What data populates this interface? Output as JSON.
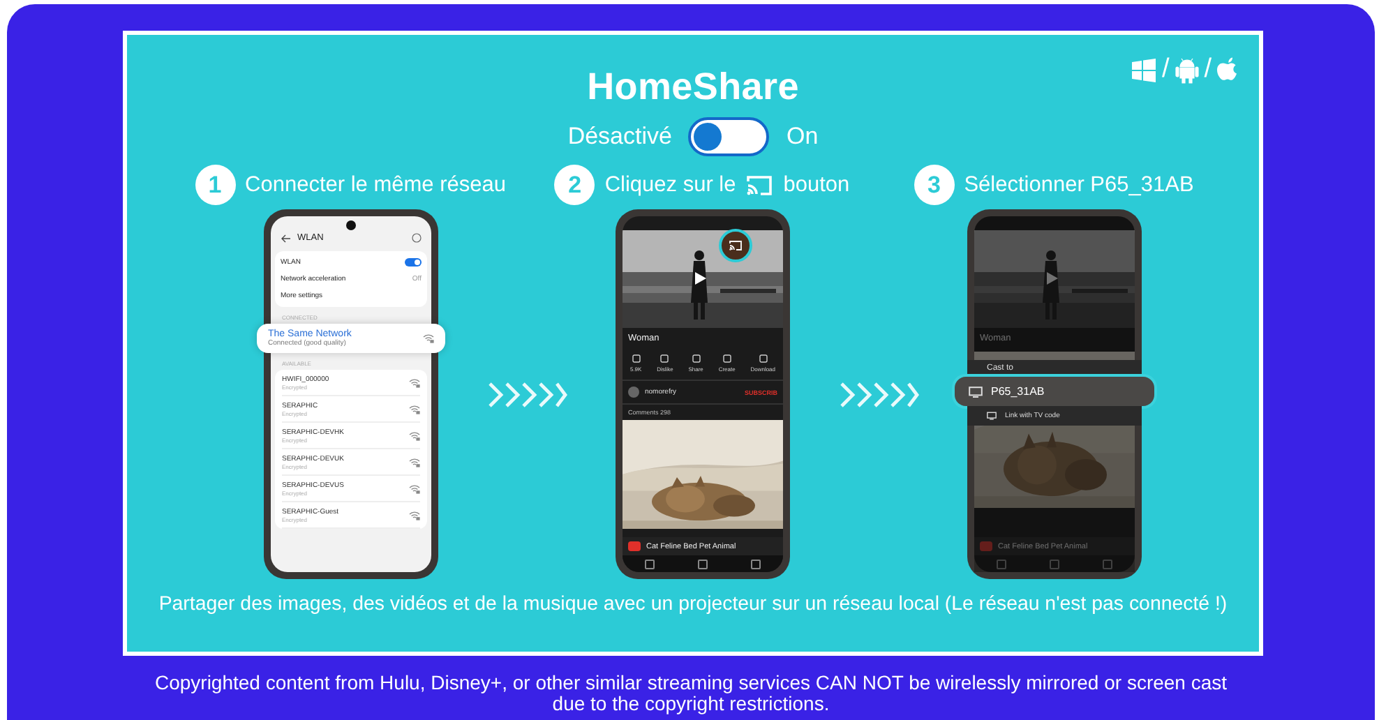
{
  "header": {
    "title": "HomeShare",
    "toggle": {
      "off_label": "Désactivé",
      "on_label": "On",
      "on": false
    }
  },
  "platform_separators": [
    "/",
    "/"
  ],
  "steps": [
    {
      "number": "1",
      "text_before": "Connecter le même réseau",
      "phone": {
        "kind": "wifi",
        "title": "WLAN",
        "settings": [
          {
            "label": "WLAN",
            "kind": "toggle",
            "on": true
          },
          {
            "label": "Network acceleration",
            "kind": "value",
            "value": "Off"
          },
          {
            "label": "More settings",
            "kind": "link"
          }
        ],
        "connected_header": "CONNECTED",
        "connected": {
          "name": "The Same Network",
          "status": "Connected (good quality)"
        },
        "available_header": "AVAILABLE",
        "networks": [
          {
            "name": "HWIFI_000000",
            "status": "Encrypted"
          },
          {
            "name": "SERAPHIC",
            "status": "Encrypted"
          },
          {
            "name": "SERAPHIC-DEVHK",
            "status": "Encrypted"
          },
          {
            "name": "SERAPHIC-DEVUK",
            "status": "Encrypted"
          },
          {
            "name": "SERAPHIC-DEVUS",
            "status": "Encrypted"
          },
          {
            "name": "SERAPHIC-Guest",
            "status": "Encrypted"
          }
        ]
      }
    },
    {
      "number": "2",
      "text_before": "Cliquez sur le",
      "text_after": "bouton",
      "phone": {
        "kind": "video",
        "title": "Woman",
        "actions": [
          "5.9K",
          "Dislike",
          "Share",
          "Create",
          "Download"
        ],
        "channel": "nomorefry",
        "subscribe": "SUBSCRIB",
        "comments": "Comments 298",
        "next_title": "Cat Feline Bed Pet Animal"
      }
    },
    {
      "number": "3",
      "text_before": "Sélectionner P65_31AB",
      "phone": {
        "kind": "cast",
        "title": "Woman",
        "menu_title": "Cast to",
        "devices": [
          {
            "name": "P65_31AB",
            "highlighted": true
          },
          {
            "name": "Link with TV code",
            "highlighted": false
          }
        ],
        "next_title": "Cat Feline Bed Pet Animal"
      }
    }
  ],
  "note": "Partager des images, des vidéos et de la musique avec un projecteur sur un réseau local (Le réseau n'est pas connecté !)",
  "footer": [
    "Copyrighted content from Hulu, Disney+, or other similar streaming services CAN NOT be wirelessly mirrored or screen cast",
    "due to the copyright restrictions."
  ]
}
